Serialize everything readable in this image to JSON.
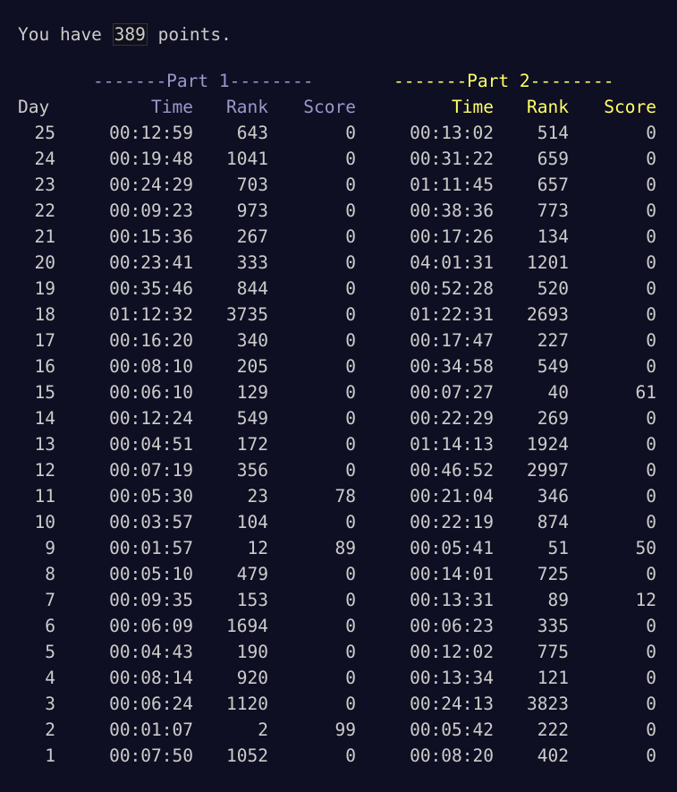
{
  "summary": {
    "prefix": "You have ",
    "points": "389",
    "suffix": " points."
  },
  "headers": {
    "part1_banner": "-------Part 1--------",
    "part2_banner": "-------Part 2--------",
    "day": "Day",
    "p1_time": "Time",
    "p1_rank": "Rank",
    "p1_score": "Score",
    "p2_time": "Time",
    "p2_rank": "Rank",
    "p2_score": "Score"
  },
  "colors": {
    "background": "#0f0f23",
    "text": "#cccccc",
    "part1": "#9999cc",
    "part2": "#ffff66"
  },
  "rows": [
    {
      "day": "25",
      "p1_time": "00:12:59",
      "p1_rank": "643",
      "p1_score": "0",
      "p2_time": "00:13:02",
      "p2_rank": "514",
      "p2_score": "0"
    },
    {
      "day": "24",
      "p1_time": "00:19:48",
      "p1_rank": "1041",
      "p1_score": "0",
      "p2_time": "00:31:22",
      "p2_rank": "659",
      "p2_score": "0"
    },
    {
      "day": "23",
      "p1_time": "00:24:29",
      "p1_rank": "703",
      "p1_score": "0",
      "p2_time": "01:11:45",
      "p2_rank": "657",
      "p2_score": "0"
    },
    {
      "day": "22",
      "p1_time": "00:09:23",
      "p1_rank": "973",
      "p1_score": "0",
      "p2_time": "00:38:36",
      "p2_rank": "773",
      "p2_score": "0"
    },
    {
      "day": "21",
      "p1_time": "00:15:36",
      "p1_rank": "267",
      "p1_score": "0",
      "p2_time": "00:17:26",
      "p2_rank": "134",
      "p2_score": "0"
    },
    {
      "day": "20",
      "p1_time": "00:23:41",
      "p1_rank": "333",
      "p1_score": "0",
      "p2_time": "04:01:31",
      "p2_rank": "1201",
      "p2_score": "0"
    },
    {
      "day": "19",
      "p1_time": "00:35:46",
      "p1_rank": "844",
      "p1_score": "0",
      "p2_time": "00:52:28",
      "p2_rank": "520",
      "p2_score": "0"
    },
    {
      "day": "18",
      "p1_time": "01:12:32",
      "p1_rank": "3735",
      "p1_score": "0",
      "p2_time": "01:22:31",
      "p2_rank": "2693",
      "p2_score": "0"
    },
    {
      "day": "17",
      "p1_time": "00:16:20",
      "p1_rank": "340",
      "p1_score": "0",
      "p2_time": "00:17:47",
      "p2_rank": "227",
      "p2_score": "0"
    },
    {
      "day": "16",
      "p1_time": "00:08:10",
      "p1_rank": "205",
      "p1_score": "0",
      "p2_time": "00:34:58",
      "p2_rank": "549",
      "p2_score": "0"
    },
    {
      "day": "15",
      "p1_time": "00:06:10",
      "p1_rank": "129",
      "p1_score": "0",
      "p2_time": "00:07:27",
      "p2_rank": "40",
      "p2_score": "61"
    },
    {
      "day": "14",
      "p1_time": "00:12:24",
      "p1_rank": "549",
      "p1_score": "0",
      "p2_time": "00:22:29",
      "p2_rank": "269",
      "p2_score": "0"
    },
    {
      "day": "13",
      "p1_time": "00:04:51",
      "p1_rank": "172",
      "p1_score": "0",
      "p2_time": "01:14:13",
      "p2_rank": "1924",
      "p2_score": "0"
    },
    {
      "day": "12",
      "p1_time": "00:07:19",
      "p1_rank": "356",
      "p1_score": "0",
      "p2_time": "00:46:52",
      "p2_rank": "2997",
      "p2_score": "0"
    },
    {
      "day": "11",
      "p1_time": "00:05:30",
      "p1_rank": "23",
      "p1_score": "78",
      "p2_time": "00:21:04",
      "p2_rank": "346",
      "p2_score": "0"
    },
    {
      "day": "10",
      "p1_time": "00:03:57",
      "p1_rank": "104",
      "p1_score": "0",
      "p2_time": "00:22:19",
      "p2_rank": "874",
      "p2_score": "0"
    },
    {
      "day": "9",
      "p1_time": "00:01:57",
      "p1_rank": "12",
      "p1_score": "89",
      "p2_time": "00:05:41",
      "p2_rank": "51",
      "p2_score": "50"
    },
    {
      "day": "8",
      "p1_time": "00:05:10",
      "p1_rank": "479",
      "p1_score": "0",
      "p2_time": "00:14:01",
      "p2_rank": "725",
      "p2_score": "0"
    },
    {
      "day": "7",
      "p1_time": "00:09:35",
      "p1_rank": "153",
      "p1_score": "0",
      "p2_time": "00:13:31",
      "p2_rank": "89",
      "p2_score": "12"
    },
    {
      "day": "6",
      "p1_time": "00:06:09",
      "p1_rank": "1694",
      "p1_score": "0",
      "p2_time": "00:06:23",
      "p2_rank": "335",
      "p2_score": "0"
    },
    {
      "day": "5",
      "p1_time": "00:04:43",
      "p1_rank": "190",
      "p1_score": "0",
      "p2_time": "00:12:02",
      "p2_rank": "775",
      "p2_score": "0"
    },
    {
      "day": "4",
      "p1_time": "00:08:14",
      "p1_rank": "920",
      "p1_score": "0",
      "p2_time": "00:13:34",
      "p2_rank": "121",
      "p2_score": "0"
    },
    {
      "day": "3",
      "p1_time": "00:06:24",
      "p1_rank": "1120",
      "p1_score": "0",
      "p2_time": "00:24:13",
      "p2_rank": "3823",
      "p2_score": "0"
    },
    {
      "day": "2",
      "p1_time": "00:01:07",
      "p1_rank": "2",
      "p1_score": "99",
      "p2_time": "00:05:42",
      "p2_rank": "222",
      "p2_score": "0"
    },
    {
      "day": "1",
      "p1_time": "00:07:50",
      "p1_rank": "1052",
      "p1_score": "0",
      "p2_time": "00:08:20",
      "p2_rank": "402",
      "p2_score": "0"
    }
  ]
}
